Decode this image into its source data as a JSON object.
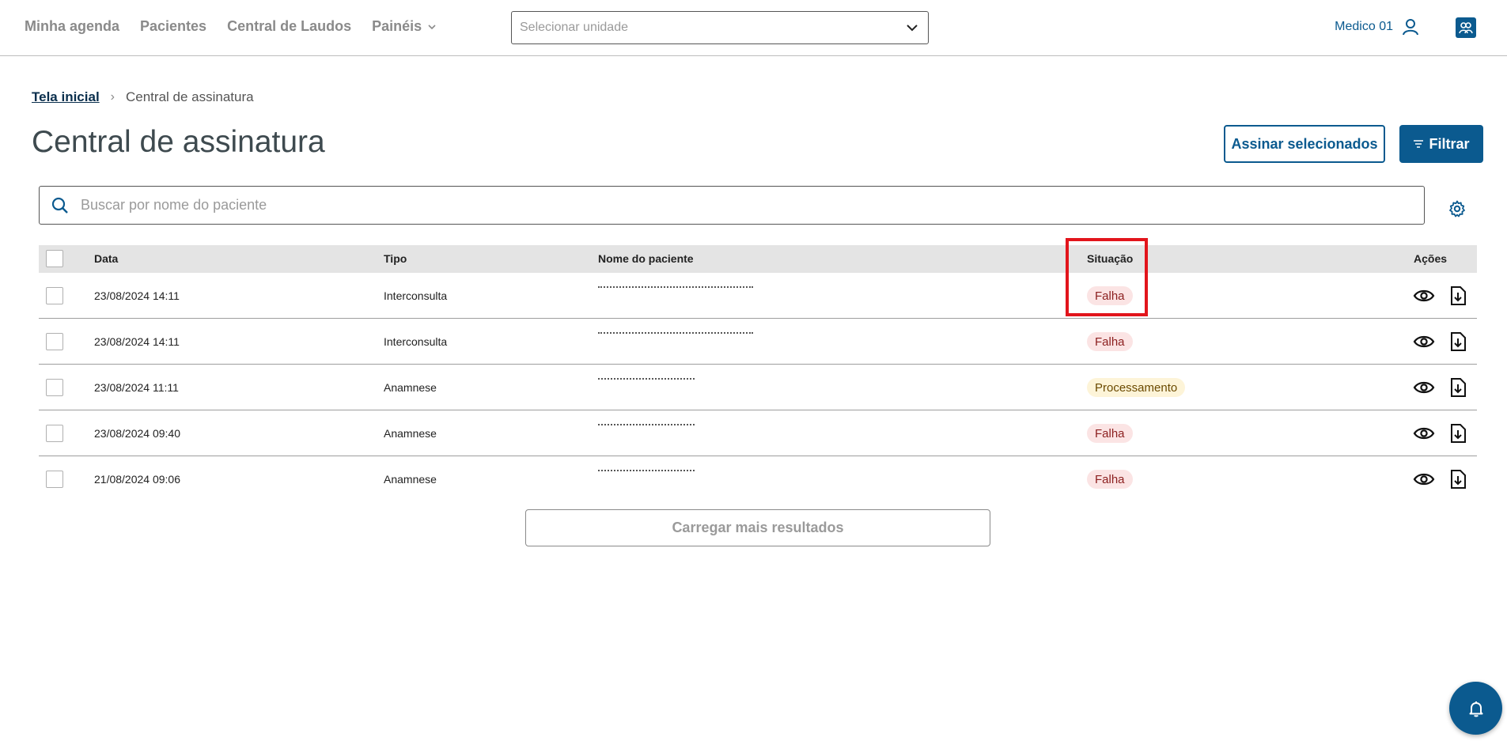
{
  "nav": {
    "items": [
      "Minha agenda",
      "Pacientes",
      "Central de Laudos",
      "Painéis"
    ]
  },
  "unit_select": {
    "placeholder": "Selecionar unidade"
  },
  "user": {
    "name": "Medico 01"
  },
  "breadcrumb": {
    "home": "Tela inicial",
    "current": "Central de assinatura"
  },
  "page": {
    "title": "Central de assinatura"
  },
  "actions": {
    "sign_selected": "Assinar selecionados",
    "filter": "Filtrar"
  },
  "search": {
    "placeholder": "Buscar por nome do paciente"
  },
  "table": {
    "headers": {
      "date": "Data",
      "type": "Tipo",
      "patient": "Nome do paciente",
      "status": "Situação",
      "actions": "Ações"
    },
    "rows": [
      {
        "date": "23/08/2024 14:11",
        "type": "Interconsulta",
        "status": "Falha"
      },
      {
        "date": "23/08/2024 14:11",
        "type": "Interconsulta",
        "status": "Falha"
      },
      {
        "date": "23/08/2024 11:11",
        "type": "Anamnese",
        "status": "Processamento"
      },
      {
        "date": "23/08/2024 09:40",
        "type": "Anamnese",
        "status": "Falha"
      },
      {
        "date": "21/08/2024 09:06",
        "type": "Anamnese",
        "status": "Falha"
      }
    ]
  },
  "load_more": "Carregar mais resultados",
  "colors": {
    "primary": "#0b5a8f",
    "fail_bg": "#fbe4e4",
    "processing_bg": "#fdf4d8",
    "highlight": "#e2151c"
  }
}
